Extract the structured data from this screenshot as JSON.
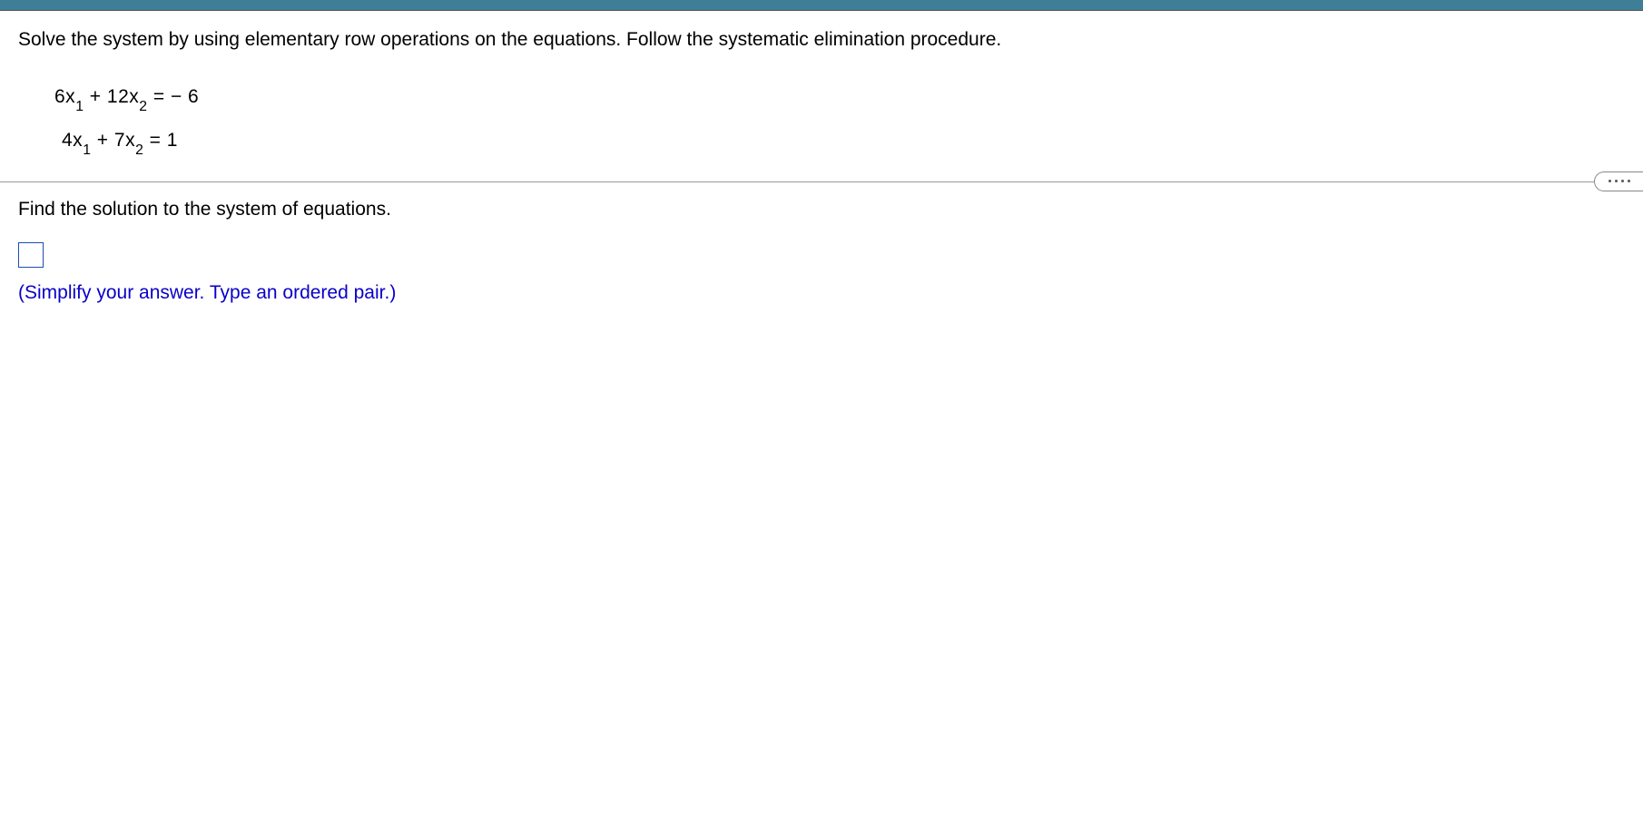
{
  "question": "Solve the system by using elementary row operations on the equations. Follow the systematic elimination procedure.",
  "equations": {
    "eq1": {
      "a11": "6x",
      "sub1": "1",
      "plus": " + ",
      "a12": "12x",
      "sub2": "2",
      "rhs": " = − 6"
    },
    "eq2": {
      "a21": "4x",
      "sub1": "1",
      "plus": " + ",
      "a22": "7x",
      "sub2": "2",
      "rhs": " = 1"
    }
  },
  "prompt": "Find the solution to the system of equations.",
  "answer_value": "",
  "hint": "(Simplify your answer. Type an ordered pair.)"
}
